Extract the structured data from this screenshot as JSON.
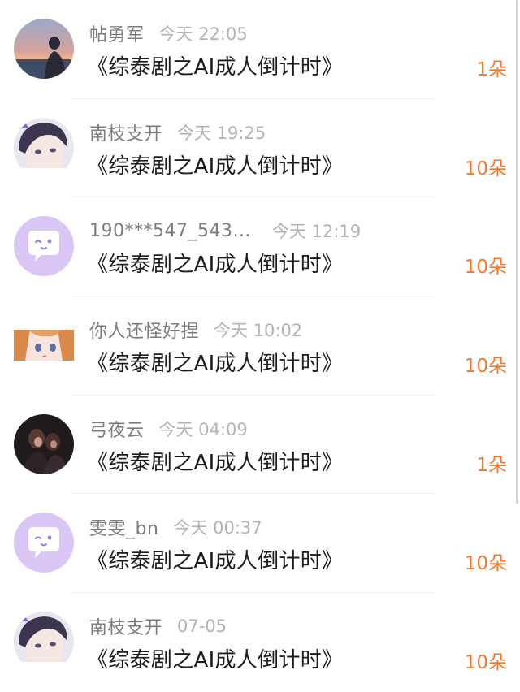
{
  "comments": [
    {
      "username": "帖勇军",
      "time": "今天 22:05",
      "title": "《综泰剧之AI成人倒计时》",
      "gift": "1朵",
      "avatar": "sunset-silhouette-avatar"
    },
    {
      "username": "南枝支开",
      "time": "今天 19:25",
      "title": "《综泰剧之AI成人倒计时》",
      "gift": "10朵",
      "avatar": "anime-boy-avatar"
    },
    {
      "username": "190***547_543…",
      "time": "今天 12:19",
      "title": "《综泰剧之AI成人倒计时》",
      "gift": "10朵",
      "avatar": "default-chat-avatar"
    },
    {
      "username": "你人还怪好捏",
      "time": "今天 10:02",
      "title": "《综泰剧之AI成人倒计时》",
      "gift": "10朵",
      "avatar": "anime-girl-avatar"
    },
    {
      "username": "弓夜云",
      "time": "今天 04:09",
      "title": "《综泰剧之AI成人倒计时》",
      "gift": "1朵",
      "avatar": "dark-couple-avatar"
    },
    {
      "username": "雯雯_bn",
      "time": "今天 00:37",
      "title": "《综泰剧之AI成人倒计时》",
      "gift": "10朵",
      "avatar": "default-chat-avatar"
    },
    {
      "username": "南枝支开",
      "time": "07-05",
      "title": "《综泰剧之AI成人倒计时》",
      "gift": "10朵",
      "avatar": "anime-boy-avatar"
    }
  ],
  "colors": {
    "accent": "#f07a30",
    "username": "#7c7c7c",
    "time": "#b3b3b3",
    "title": "#1c1c1c",
    "default_avatar_bg": "#d9c6f5"
  }
}
